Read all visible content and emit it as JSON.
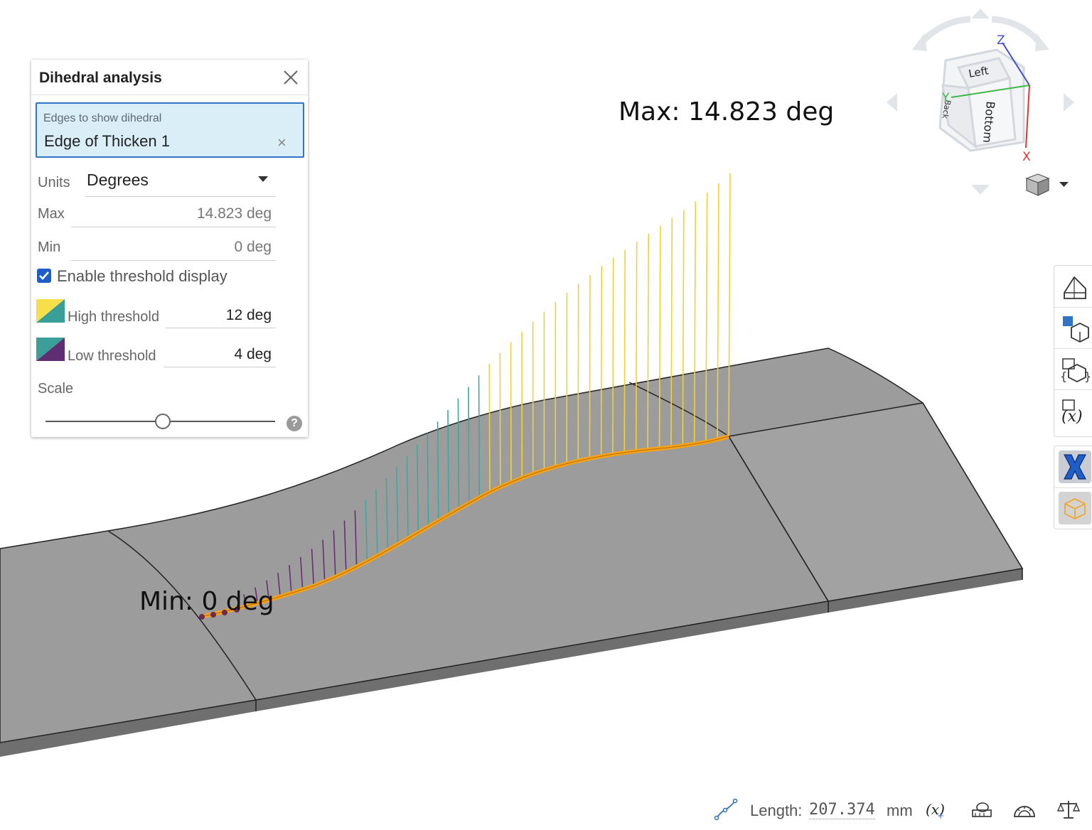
{
  "viewport": {
    "max_label": "Max: 14.823 deg",
    "min_label": "Min: 0 deg",
    "colors": {
      "face_top": "#9a9a9a",
      "face_side": "#6f6f6f",
      "edge_highlight": "#f4a21b",
      "high_lines": "#f2d233",
      "mid_lines": "#3fa6a0",
      "low_lines": "#6b2c73",
      "background": "#ffffff"
    }
  },
  "dialog": {
    "title": "Dihedral analysis",
    "close_icon": "close-icon",
    "edges_label": "Edges to show dihedral",
    "edges_value": "Edge of Thicken 1",
    "clear_icon": "×",
    "units_label": "Units",
    "units_value": "Degrees",
    "max_label": "Max",
    "max_value": "14.823 deg",
    "min_label": "Min",
    "min_value": "0 deg",
    "enable_threshold_label": "Enable threshold display",
    "enable_threshold_checked": true,
    "high_threshold_label": "High threshold",
    "high_threshold_value": "12 deg",
    "low_threshold_label": "Low threshold",
    "low_threshold_value": "4 deg",
    "scale_label": "Scale",
    "scale_value": 0.51,
    "help_icon": "?"
  },
  "viewcube": {
    "face_left": "Left",
    "face_bottom": "Bottom",
    "face_back": "Back",
    "axis_x": "X",
    "axis_y": "Y",
    "axis_z": "Z"
  },
  "right_toolbar": {
    "items": [
      "section-view-icon",
      "named-views-icon",
      "configurations-icon",
      "variables-icon",
      "x-close-icon",
      "display-states-icon"
    ]
  },
  "status": {
    "length_label": "Length:",
    "length_value": "207.374",
    "length_unit": "mm"
  }
}
